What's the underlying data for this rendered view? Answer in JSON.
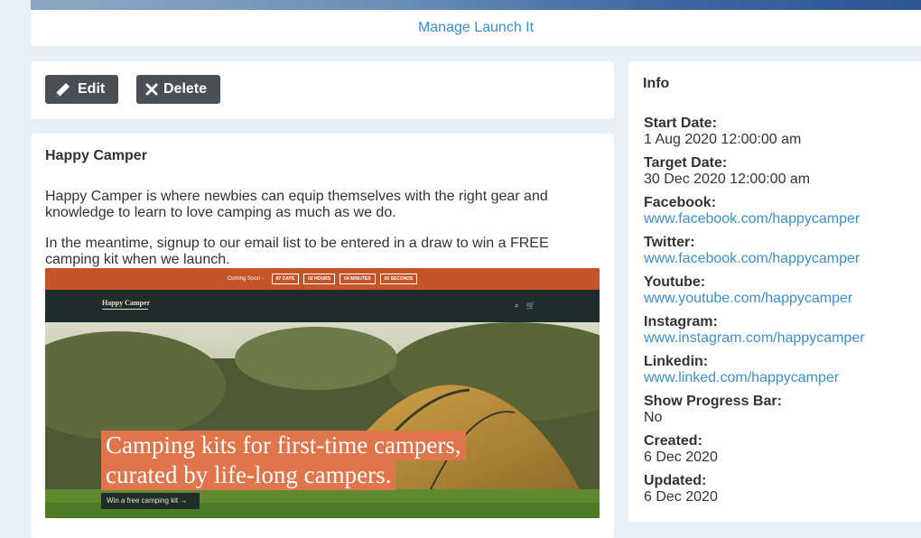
{
  "manage_link": "Manage Launch It",
  "actions": {
    "edit_label": "Edit",
    "delete_label": "Delete"
  },
  "campaign": {
    "title": "Happy Camper",
    "description_1": "Happy Camper is where newbies can equip themselves with the right gear and knowledge to learn to love camping as much as we do.",
    "description_2": "In the meantime, signup to our email list to be entered in a draw to win a FREE camping kit when we launch."
  },
  "preview": {
    "coming_soon": "Coming Soon -",
    "countdown": [
      "87 DAYS",
      "02 HOURS",
      "04 MINUTES",
      "50 SECONDS"
    ],
    "brand": "Happy Camper",
    "headline_1": "Camping kits for first-time campers,",
    "headline_2": "curated by life-long campers.",
    "cta": "Win a free camping kit →"
  },
  "info": {
    "title": "Info",
    "items": [
      {
        "label": "Start Date:",
        "value": "1 Aug 2020 12:00:00 am",
        "is_link": false
      },
      {
        "label": "Target Date:",
        "value": "30 Dec 2020 12:00:00 am",
        "is_link": false
      },
      {
        "label": "Facebook:",
        "value": "www.facebook.com/happycamper",
        "is_link": true
      },
      {
        "label": "Twitter:",
        "value": "www.facebook.com/happycamper",
        "is_link": true
      },
      {
        "label": "Youtube:",
        "value": "www.youtube.com/happycamper",
        "is_link": true
      },
      {
        "label": "Instagram:",
        "value": "www.instagram.com/happycamper",
        "is_link": true
      },
      {
        "label": "Linkedin:",
        "value": "www.linked.com/happycamper",
        "is_link": true
      },
      {
        "label": "Show Progress Bar:",
        "value": "No",
        "is_link": false
      },
      {
        "label": "Created:",
        "value": "6 Dec 2020",
        "is_link": false
      },
      {
        "label": "Updated:",
        "value": "6 Dec 2020",
        "is_link": false
      }
    ]
  },
  "colors": {
    "link": "#3b8fd4",
    "button": "#4a4f55",
    "background": "#e8f0f7",
    "preview_accent": "#e0744a"
  }
}
